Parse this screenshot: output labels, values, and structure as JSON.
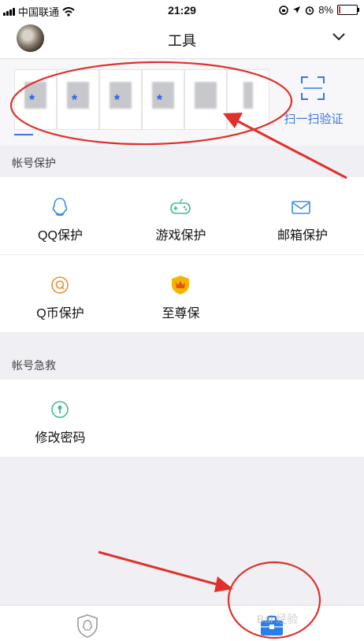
{
  "status_bar": {
    "carrier": "中国联通",
    "time": "21:29",
    "battery": "8%",
    "battery_level": 0.08
  },
  "header": {
    "title": "工具"
  },
  "token_strip": {
    "card_count": 6,
    "scan_label": "扫一扫验证"
  },
  "sections": [
    {
      "title": "帐号保护",
      "items": [
        {
          "label": "QQ保护",
          "icon": "qq-penguin-icon"
        },
        {
          "label": "游戏保护",
          "icon": "gamepad-icon"
        },
        {
          "label": "邮箱保护",
          "icon": "mail-icon"
        },
        {
          "label": "Q币保护",
          "icon": "q-coin-icon"
        },
        {
          "label": "至尊保",
          "icon": "premium-shield-icon"
        }
      ]
    },
    {
      "title": "帐号急救",
      "items": [
        {
          "label": "修改密码",
          "icon": "key-pin-icon"
        }
      ]
    }
  ],
  "tab_bar": {
    "tabs": [
      {
        "icon": "shield-penguin-icon",
        "active": false
      },
      {
        "icon": "toolbox-icon",
        "active": true
      }
    ]
  },
  "watermark": "Bai 经验",
  "colors": {
    "accent": "#3a76e8",
    "annotation": "#e0302a",
    "background": "#efeff4"
  }
}
